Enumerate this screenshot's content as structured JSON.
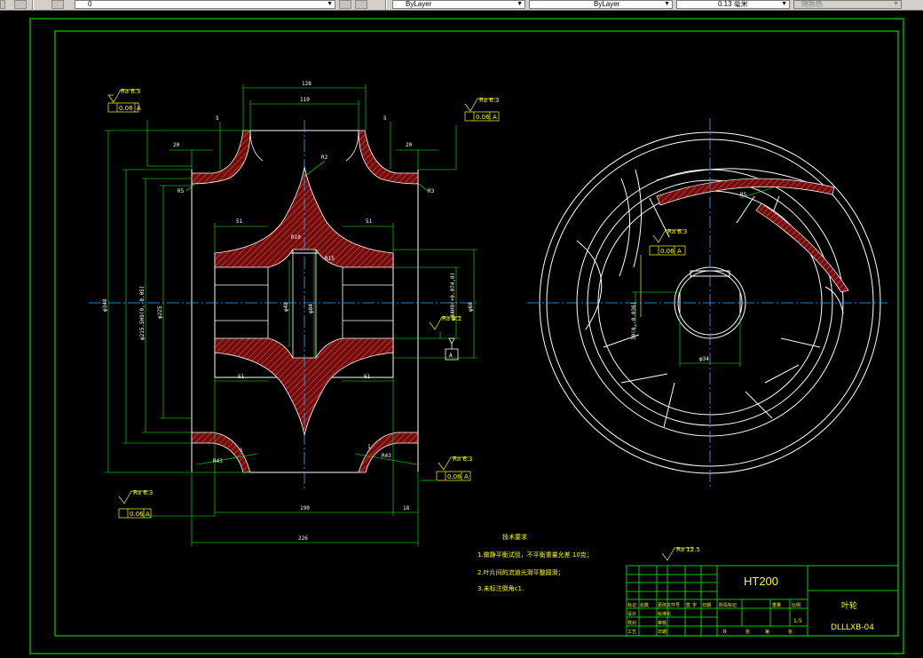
{
  "toolbar": {
    "layer_value": "0",
    "color_value": "ByLayer",
    "linetype_value": "ByLayer",
    "lineweight_value": "0.13 毫米",
    "plotstyle_value": "随颜色"
  },
  "drawing": {
    "dims_section": {
      "top_outer": "128",
      "top_inner": "110",
      "left_20": "20",
      "right_20": "20",
      "left_5": "5",
      "right_5": "5",
      "left_51": "51",
      "right_51": "51",
      "left_61": "61",
      "right_61": "61",
      "r2": "R2",
      "r5": "R5",
      "r3": "R3",
      "r10": "R10",
      "r15": "R15",
      "r43_left": "R43",
      "r43_right": "R43",
      "r1_left": "1",
      "r1_right": "1",
      "phi_outer": "φ348",
      "phi_2": "φ215.5H9(0,-0.05)",
      "phi_3": "φ225",
      "phi_4": "φ84",
      "phi_5": "φ48",
      "phi_key": "φ44H9(+0.074,0)",
      "phi_60": "φ60",
      "bottom_190": "190",
      "bottom_18": "18",
      "bottom_226": "226",
      "datum_a": "A"
    },
    "tolerances": {
      "tl_rough": "Ra 6.3",
      "tl_val": "0.06",
      "tr_rough": "Ra 6.3",
      "tr_val": "0.06",
      "mid_rough": "Ra 3.2",
      "bl_rough": "Ra 6.3",
      "bl_val": "0.06",
      "br_rough": "Ra 6.3",
      "br_val": "0.06",
      "front_rough": "Ra 6.3",
      "front_val": "0.06",
      "front_datum": "A",
      "letter_a": "A"
    },
    "front_view": {
      "r5": "R5",
      "phi_hub": "φ34",
      "keyway": "10(0,-0.036)"
    },
    "notes": {
      "title": "技术要求",
      "line1": "1.做静平衡试验，不平衡重量允差 10克；",
      "line2": "2.叶片间的流道光滑平整圆滑；",
      "line3": "3.未标注倒角c1."
    },
    "title_block": {
      "roughness": "Ra 12.5",
      "material": "HT200",
      "part_name": "叶轮",
      "drawing_no": "DLLLXB-04",
      "scale": "1:5",
      "row_a": [
        "标记",
        "处数",
        "更改文件号",
        "签",
        "字",
        "日期"
      ],
      "row_b": [
        "设计",
        "",
        "标准化",
        "",
        "",
        ""
      ],
      "row_c": [
        "校对",
        "",
        "审核",
        "",
        "",
        ""
      ],
      "row_d": [
        "工艺",
        "",
        "日期",
        "",
        "",
        ""
      ],
      "col_labels": [
        "阶段标记",
        "重量",
        "比例"
      ],
      "sheet": [
        "共",
        "张",
        "第",
        "张"
      ]
    }
  }
}
